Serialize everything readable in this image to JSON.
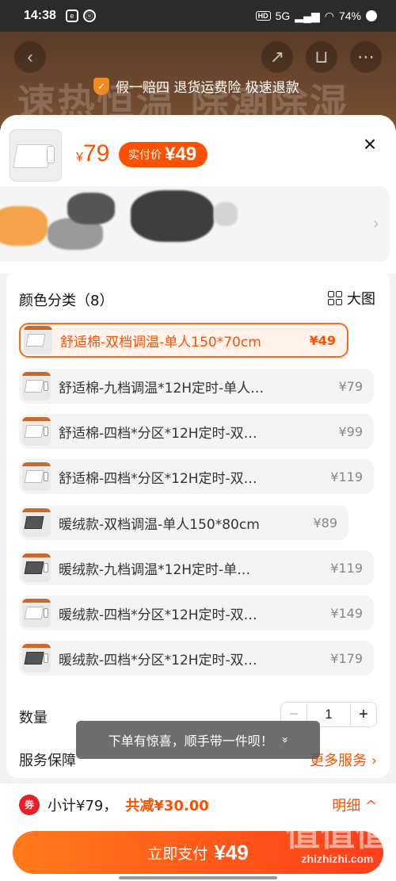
{
  "status_bar": {
    "time": "14:38",
    "network": "5G",
    "battery": "74%"
  },
  "banner": {
    "background_text": "速热恒温 除潮除湿",
    "guarantee_text": "假一赔四 退货运费险 极速退款"
  },
  "header": {
    "price_symbol": "¥",
    "price": "79",
    "actual_price_label": "实付价",
    "actual_price": "¥49"
  },
  "options": {
    "title": "颜色分类（8）",
    "big_view_label": "大图",
    "items": [
      {
        "name": "舒适棉-双档调温-单人150*70cm",
        "price": "¥49",
        "selected": true
      },
      {
        "name": "舒适棉-九档调温*12H定时-单人…",
        "price": "¥79"
      },
      {
        "name": "舒适棉-四档*分区*12H定时-双…",
        "price": "¥99"
      },
      {
        "name": "舒适棉-四档*分区*12H定时-双…",
        "price": "¥119"
      },
      {
        "name": "暖绒款-双档调温-单人150*80cm",
        "price": "¥89"
      },
      {
        "name": "暖绒款-九档调温*12H定时-单…",
        "price": "¥119"
      },
      {
        "name": "暖绒款-四档*分区*12H定时-双…",
        "price": "¥149"
      },
      {
        "name": "暖绒款-四档*分区*12H定时-双…",
        "price": "¥179"
      }
    ]
  },
  "quantity": {
    "label": "数量",
    "value": "1",
    "minus": "−",
    "plus": "+"
  },
  "service": {
    "label": "服务保障",
    "more": "更多服务 ›"
  },
  "toast": {
    "text": "下单有惊喜，顺手带一件呗！",
    "icon": "»"
  },
  "footer": {
    "subtotal": "小计¥79，",
    "reduction": "共减¥30.00",
    "detail": "明细 ^",
    "pay_label": "立即支付",
    "pay_amount": "¥49"
  },
  "watermark": {
    "text": "值值值",
    "url": "zhizhizhi.com"
  },
  "colors": {
    "accent": "#ff5000",
    "selected_border": "#ff6a1a"
  }
}
